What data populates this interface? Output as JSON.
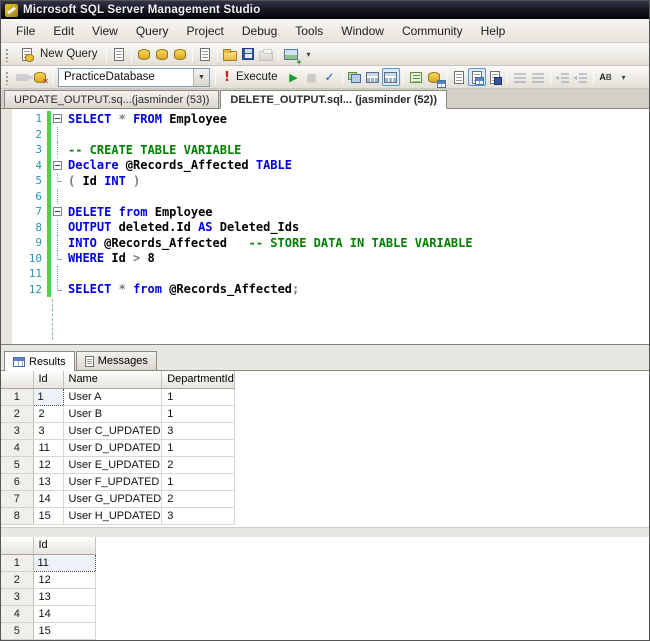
{
  "window": {
    "title": "Microsoft SQL Server Management Studio"
  },
  "menu_bar": {
    "items": [
      "File",
      "Edit",
      "View",
      "Query",
      "Project",
      "Debug",
      "Tools",
      "Window",
      "Community",
      "Help"
    ]
  },
  "standard_toolbar": {
    "new_query_label": "New Query"
  },
  "sql_toolbar": {
    "database_selector": {
      "value": "PracticeDatabase"
    },
    "execute_label": "Execute"
  },
  "icons": {
    "execute_exclamation": "!",
    "debug_play": "▶",
    "stop_square": "■",
    "parse_check": "✓",
    "combo_arrow": "▼",
    "overflow_chevron": "▾",
    "ab_a": "A",
    "ab_b": "B"
  },
  "document_tabs": [
    {
      "label": "UPDATE_OUTPUT.sq...(jasminder (53))",
      "active": false
    },
    {
      "label": "DELETE_OUTPUT.sql... (jasminder (52))",
      "active": true
    }
  ],
  "editor": {
    "lines": [
      {
        "n": "1",
        "fold": "box",
        "segs": [
          [
            "SELECT",
            "kw"
          ],
          [
            " ",
            ""
          ],
          [
            "*",
            "op"
          ],
          [
            " ",
            ""
          ],
          [
            "FROM",
            "kw"
          ],
          [
            " Employee",
            ""
          ]
        ]
      },
      {
        "n": "2",
        "fold": "vline",
        "segs": []
      },
      {
        "n": "3",
        "fold": "vline",
        "segs": [
          [
            "-- CREATE TABLE VARIABLE",
            "com"
          ]
        ]
      },
      {
        "n": "4",
        "fold": "box",
        "segs": [
          [
            "Declare",
            "kw"
          ],
          [
            " @Records_Affected ",
            ""
          ],
          [
            "TABLE",
            "kw"
          ]
        ]
      },
      {
        "n": "5",
        "fold": "end",
        "segs": [
          [
            "( ",
            "op"
          ],
          [
            "Id ",
            ""
          ],
          [
            "INT",
            "kw"
          ],
          [
            " )",
            "op"
          ]
        ]
      },
      {
        "n": "6",
        "fold": "vline",
        "segs": []
      },
      {
        "n": "7",
        "fold": "box",
        "segs": [
          [
            "DELETE",
            "kw"
          ],
          [
            " ",
            ""
          ],
          [
            "from",
            "kw"
          ],
          [
            " Employee",
            ""
          ]
        ]
      },
      {
        "n": "8",
        "fold": "vline",
        "segs": [
          [
            "OUTPUT",
            "kw"
          ],
          [
            " deleted.Id ",
            ""
          ],
          [
            "AS",
            "kw"
          ],
          [
            " Deleted_Ids",
            ""
          ]
        ]
      },
      {
        "n": "9",
        "fold": "vline",
        "segs": [
          [
            "INTO",
            "kw"
          ],
          [
            " @Records_Affected   ",
            ""
          ],
          [
            "-- STORE DATA IN TABLE VARIABLE",
            "com"
          ]
        ]
      },
      {
        "n": "10",
        "fold": "end",
        "segs": [
          [
            "WHERE",
            "kw"
          ],
          [
            " Id ",
            ""
          ],
          [
            ">",
            "op"
          ],
          [
            " 8",
            ""
          ]
        ]
      },
      {
        "n": "11",
        "fold": "vline",
        "segs": []
      },
      {
        "n": "12",
        "fold": "end",
        "segs": [
          [
            "SELECT",
            "kw"
          ],
          [
            " ",
            ""
          ],
          [
            "*",
            "op"
          ],
          [
            " ",
            ""
          ],
          [
            "from",
            "kw"
          ],
          [
            " @Records_Affected",
            ""
          ],
          [
            ";",
            "op"
          ]
        ]
      }
    ]
  },
  "results_pane": {
    "tabs": [
      {
        "label": "Results",
        "active": true
      },
      {
        "label": "Messages",
        "active": false
      }
    ],
    "grids": [
      {
        "columns": [
          "Id",
          "Name",
          "DepartmentId"
        ],
        "rows": [
          [
            "1",
            "User A",
            "1"
          ],
          [
            "2",
            "User B",
            "1"
          ],
          [
            "3",
            "User C_UPDATED",
            "3"
          ],
          [
            "11",
            "User D_UPDATED",
            "1"
          ],
          [
            "12",
            "User E_UPDATED",
            "2"
          ],
          [
            "13",
            "User F_UPDATED",
            "1"
          ],
          [
            "14",
            "User G_UPDATED",
            "2"
          ],
          [
            "15",
            "User H_UPDATED",
            "3"
          ]
        ]
      },
      {
        "columns": [
          "Id"
        ],
        "rows": [
          [
            "11"
          ],
          [
            "12"
          ],
          [
            "13"
          ],
          [
            "14"
          ],
          [
            "15"
          ]
        ]
      }
    ]
  },
  "colors": {
    "keyword": "#0000e0",
    "comment": "#008000",
    "operator": "#7a7a7a",
    "line_number": "#2b91af",
    "change_bar": "#49d549",
    "titlebar": "#0a0a14"
  }
}
